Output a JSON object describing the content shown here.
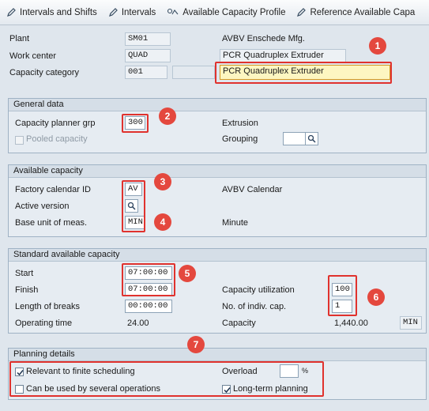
{
  "toolbar": {
    "intervals_shifts": "Intervals and Shifts",
    "intervals": "Intervals",
    "available_capacity_profile": "Available Capacity Profile",
    "reference_available_capacity": "Reference Available Capa"
  },
  "header": {
    "plant_label": "Plant",
    "plant_value": "SM01",
    "plant_desc": "AVBV Enschede Mfg.",
    "work_center_label": "Work center",
    "work_center_value": "QUAD",
    "work_center_desc": "PCR Quadruplex Extruder",
    "capacity_category_label": "Capacity category",
    "capacity_category_value": "001",
    "capacity_desc_value": "PCR Quadruplex Extruder"
  },
  "general_data": {
    "title": "General data",
    "capacity_planner_grp_label": "Capacity planner grp",
    "capacity_planner_grp_value": "300",
    "capacity_planner_grp_desc": "Extrusion",
    "pooled_capacity_label": "Pooled capacity",
    "grouping_label": "Grouping"
  },
  "available_capacity": {
    "title": "Available capacity",
    "factory_calendar_label": "Factory calendar ID",
    "factory_calendar_value": "AV",
    "factory_calendar_desc": "AVBV Calendar",
    "active_version_label": "Active version",
    "base_unit_label": "Base unit of meas.",
    "base_unit_value": "MIN",
    "base_unit_desc": "Minute"
  },
  "standard_capacity": {
    "title": "Standard available capacity",
    "start_label": "Start",
    "start_value": "07:00:00",
    "finish_label": "Finish",
    "finish_value": "07:00:00",
    "length_breaks_label": "Length of breaks",
    "length_breaks_value": "00:00:00",
    "operating_time_label": "Operating time",
    "operating_time_value": "24.00",
    "capacity_utilization_label": "Capacity utilization",
    "capacity_utilization_value": "100",
    "indiv_cap_label": "No. of indiv. cap.",
    "indiv_cap_value": "1",
    "capacity_label": "Capacity",
    "capacity_value": "1,440.00",
    "capacity_unit": "MIN"
  },
  "planning_details": {
    "title": "Planning details",
    "finite_scheduling_label": "Relevant to finite scheduling",
    "finite_scheduling_checked": true,
    "several_operations_label": "Can be used by several operations",
    "several_operations_checked": false,
    "overload_label": "Overload",
    "overload_value": "",
    "overload_unit": "%",
    "long_term_label": "Long-term planning",
    "long_term_checked": true
  },
  "annotations": [
    "1",
    "2",
    "3",
    "4",
    "5",
    "6",
    "7"
  ],
  "colors": {
    "highlight": "#e0322e",
    "badge": "#e4483e",
    "required_field": "#fdf6c1",
    "background": "#dfe6ed"
  }
}
